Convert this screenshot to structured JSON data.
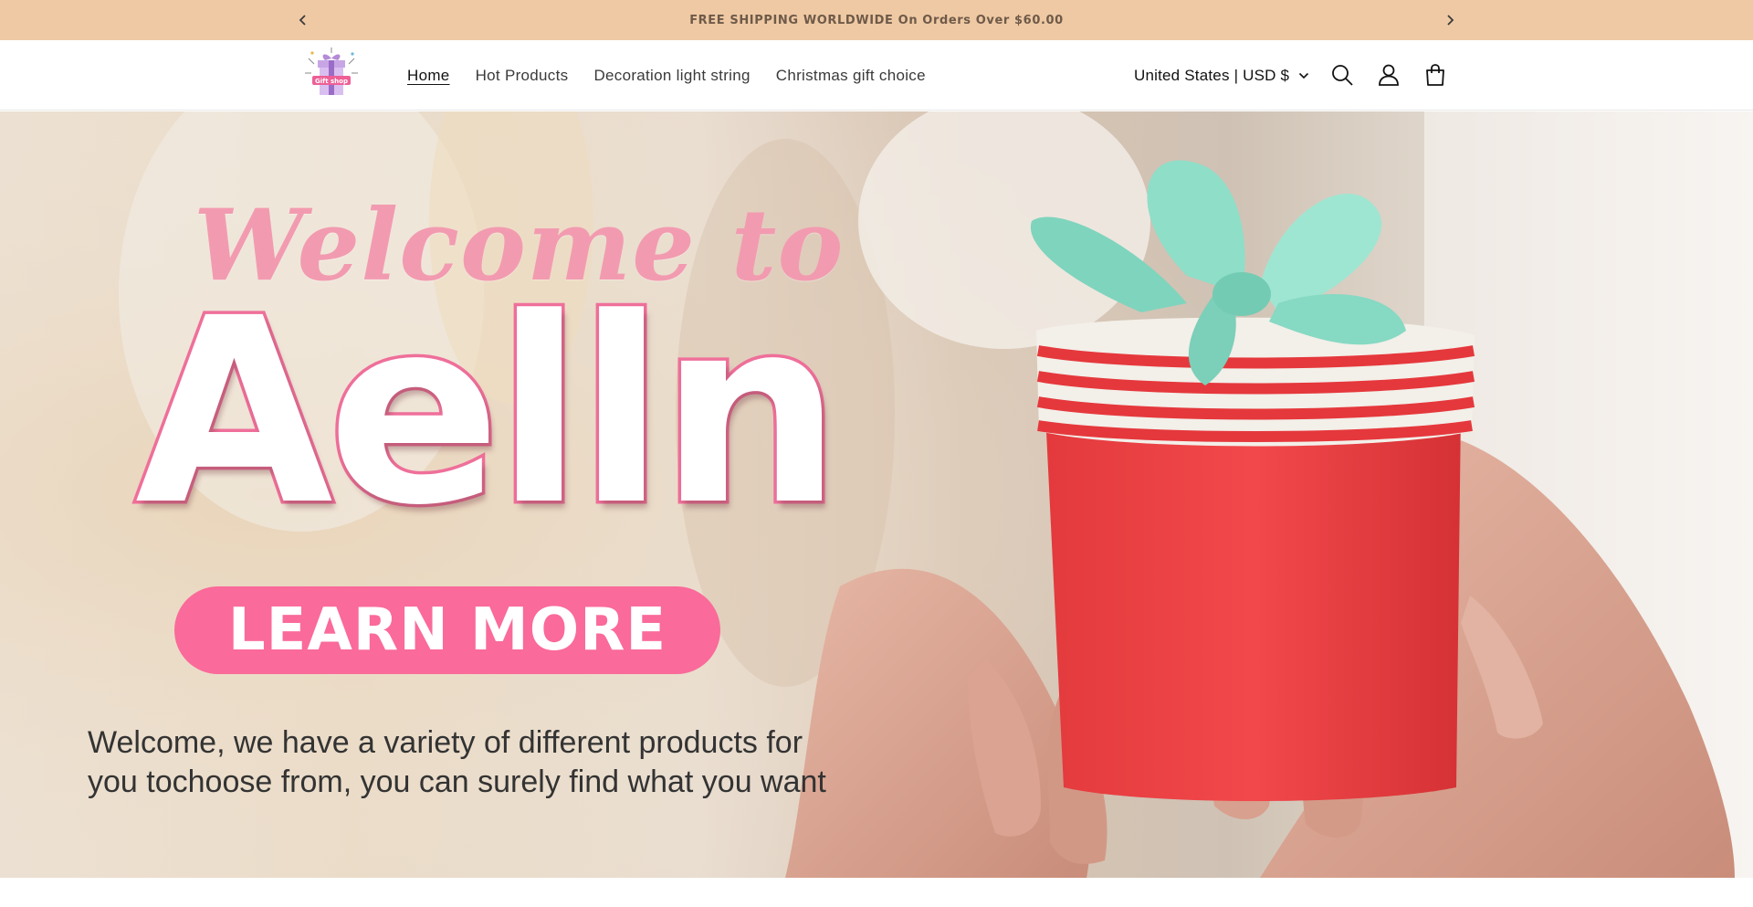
{
  "announcement": {
    "text": "FREE SHIPPING WORLDWIDE On Orders Over $60.00",
    "prev_icon": "chevron-left-icon",
    "next_icon": "chevron-right-icon",
    "background": "#efc9a3"
  },
  "header": {
    "logo_text": "Gift shop",
    "nav": [
      {
        "label": "Home",
        "active": true
      },
      {
        "label": "Hot Products"
      },
      {
        "label": "Decoration light string"
      },
      {
        "label": "Christmas gift choice"
      }
    ],
    "country_selector": "United States | USD $",
    "icons": [
      "search-icon",
      "account-icon",
      "cart-icon"
    ]
  },
  "hero": {
    "welcome": "Welcome to",
    "brand": "Aelln",
    "button": "LEARN MORE",
    "description_line1": "Welcome, we have a variety of different products for",
    "description_line2": "you tochoose from, you can surely find what you want",
    "accent_color": "#fa6a9a"
  }
}
